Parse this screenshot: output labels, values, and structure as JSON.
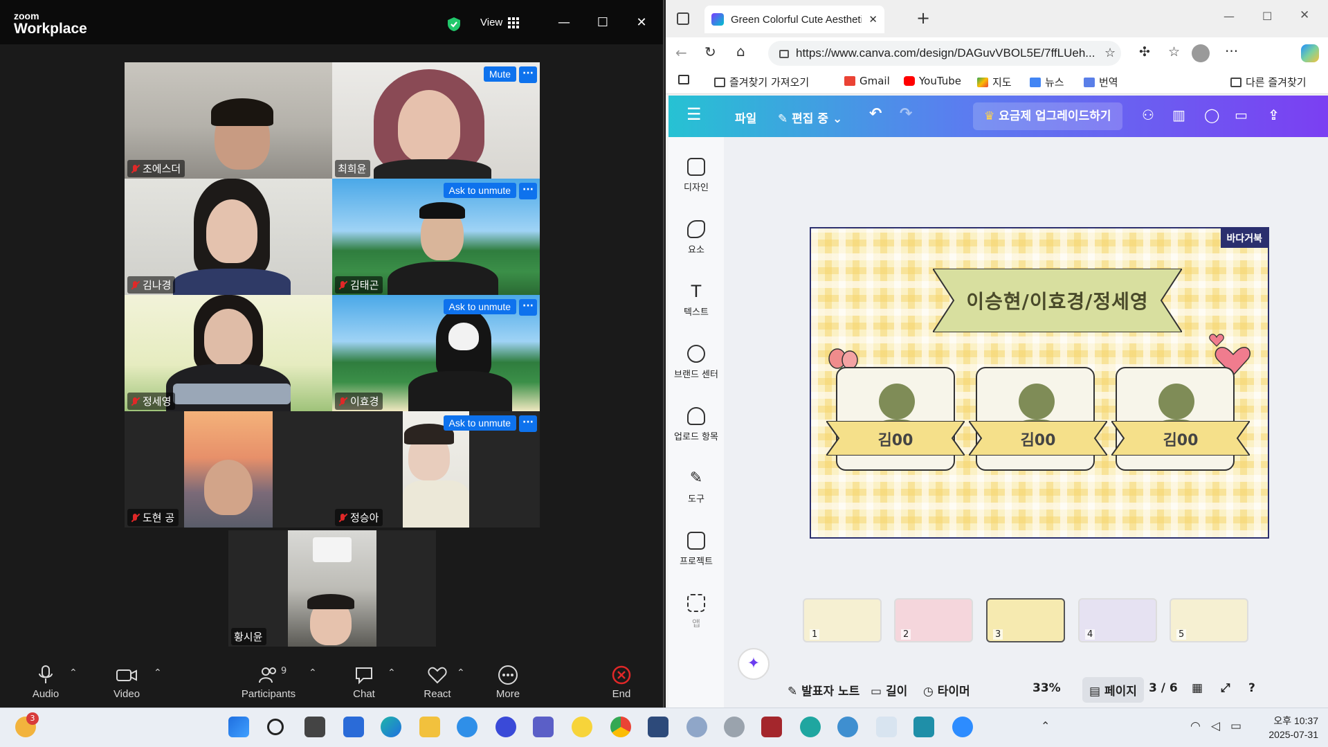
{
  "zoom": {
    "logo_line1": "zoom",
    "logo_line2": "Workplace",
    "view_label": "View",
    "participants": [
      {
        "name": "조에스더",
        "muted": true
      },
      {
        "name": "최희윤",
        "muted": false,
        "active_speaker": true,
        "button": "Mute"
      },
      {
        "name": "김나경",
        "muted": true
      },
      {
        "name": "김태곤",
        "muted": true,
        "button": "Ask to unmute"
      },
      {
        "name": "정세영",
        "muted": true
      },
      {
        "name": "이효경",
        "muted": true,
        "button": "Ask to unmute"
      },
      {
        "name": "도현 공",
        "muted": true
      },
      {
        "name": "정승아",
        "muted": true,
        "button": "Ask to unmute"
      },
      {
        "name": "황시윤",
        "muted": false
      }
    ],
    "more_dots": "···",
    "toolbar": {
      "audio": "Audio",
      "video": "Video",
      "participants": "Participants",
      "participants_count": "9",
      "chat": "Chat",
      "react": "React",
      "more": "More",
      "end": "End"
    }
  },
  "edge": {
    "tab_title": "Green Colorful Cute Aesthetic Gr",
    "url": "https://www.canva.com/design/DAGuvVBOL5E/7ffLUeh...",
    "bookmarks": [
      "즐겨찾기 가져오기",
      "Gmail",
      "YouTube",
      "지도",
      "뉴스",
      "번역"
    ],
    "other_bookmarks": "다른 즐겨찾기"
  },
  "canva": {
    "file_menu": "파일",
    "editing_label": "편집 중",
    "upgrade_label": "요금제 업그레이드하기",
    "side_items": [
      "디자인",
      "요소",
      "텍스트",
      "브랜드 센터",
      "업로드 항목",
      "도구",
      "프로젝트",
      "앱"
    ],
    "slide": {
      "badge": "바다거북",
      "title": "이승현/이효경/정세영",
      "names": [
        "김00",
        "김00",
        "김00"
      ]
    },
    "thumbnails": [
      "1",
      "2",
      "3",
      "4",
      "5"
    ],
    "selected_thumbnail": "3",
    "bottom": {
      "notes": "발표자 노트",
      "duration": "길이",
      "timer": "타이머",
      "zoom": "33%",
      "pages": "페이지",
      "page_count": "3 / 6"
    }
  },
  "taskbar": {
    "weather_badge": "3",
    "time": "오후 10:37",
    "date": "2025-07-31"
  },
  "colors": {
    "zoom_accent": "#0e72ed",
    "active_speaker": "#21c76b",
    "muted_red": "#e02828",
    "canva_gradient_start": "#26c2d3",
    "canva_gradient_end": "#7b3ff2",
    "slide_person": "#7f8c57",
    "slide_badge": "#2b2f6e"
  }
}
